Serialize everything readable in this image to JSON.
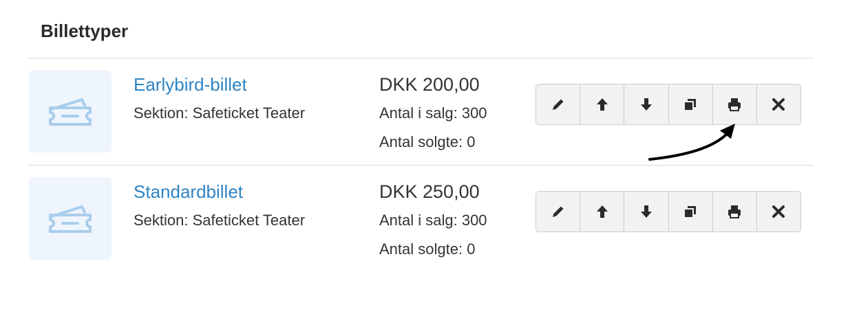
{
  "page": {
    "heading": "Billettyper"
  },
  "tickets": [
    {
      "name": "Earlybird-billet",
      "section": "Sektion: Safeticket Teater",
      "price": "DKK 200,00",
      "for_sale": "Antal i salg: 300",
      "sold": "Antal solgte: 0"
    },
    {
      "name": "Standardbillet",
      "section": "Sektion: Safeticket Teater",
      "price": "DKK 250,00",
      "for_sale": "Antal i salg: 300",
      "sold": "Antal solgte: 0"
    }
  ],
  "actions": [
    {
      "name": "edit",
      "icon": "pencil-icon"
    },
    {
      "name": "move-up",
      "icon": "arrow-up-icon"
    },
    {
      "name": "move-down",
      "icon": "arrow-down-icon"
    },
    {
      "name": "copy",
      "icon": "copy-icon"
    },
    {
      "name": "print",
      "icon": "print-icon"
    },
    {
      "name": "delete",
      "icon": "close-icon"
    }
  ],
  "colors": {
    "link": "#2e84c2",
    "thumb_bg": "#eef5fc",
    "icon_ticket": "#a9cdec",
    "button_bg": "#f2f2f2"
  }
}
